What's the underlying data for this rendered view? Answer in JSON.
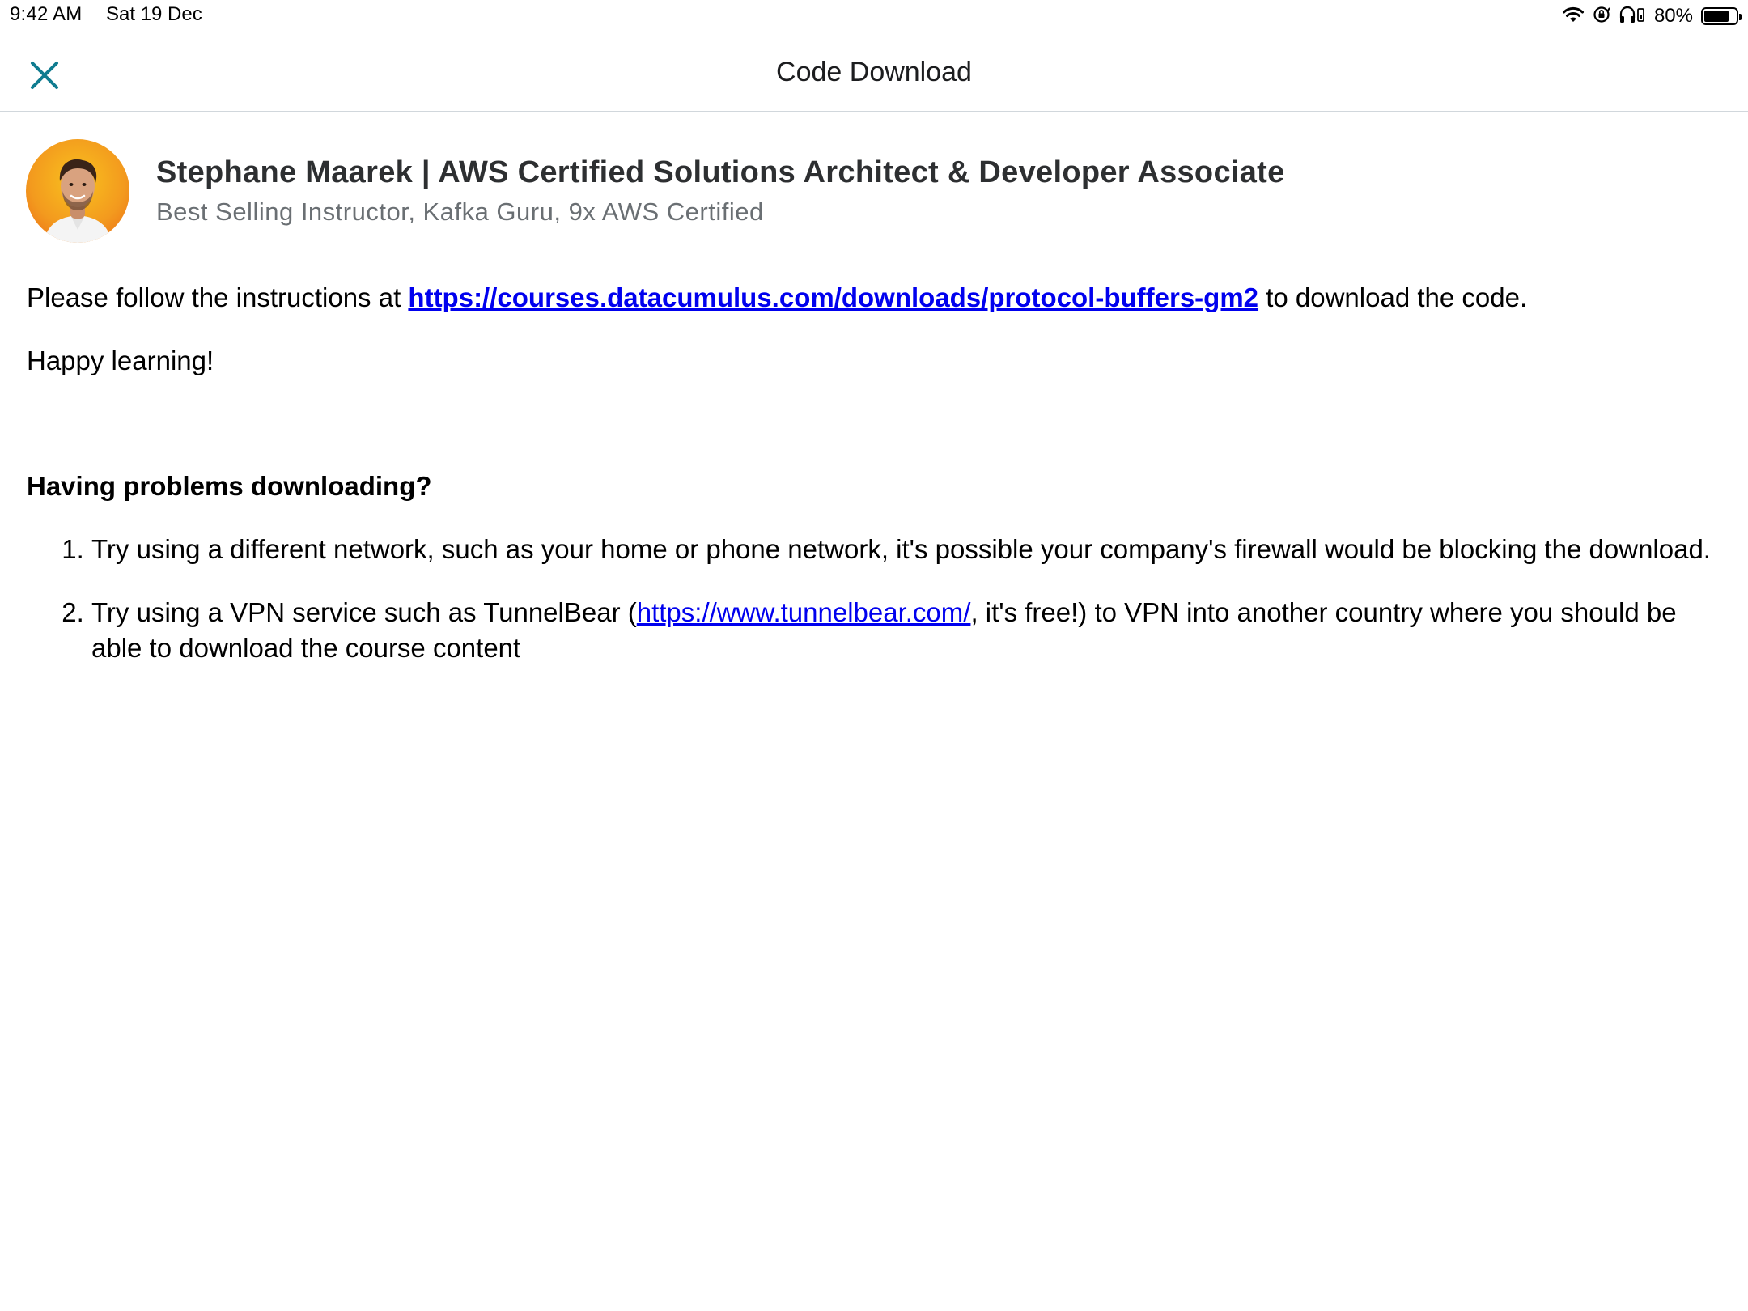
{
  "status_bar": {
    "time": "9:42 AM",
    "date": "Sat 19 Dec",
    "battery_percent_label": "80%",
    "battery_level": 0.8,
    "icons": [
      "wifi-icon",
      "orientation-lock-icon",
      "headphones-icon",
      "battery-icon"
    ]
  },
  "header": {
    "title": "Code Download",
    "close_icon": "close-icon"
  },
  "instructor": {
    "name": "Stephane Maarek | AWS Certified Solutions Architect & Developer Associate",
    "title": "Best Selling Instructor, Kafka Guru, 9x AWS Certified"
  },
  "body": {
    "intro_prefix": "Please follow the instructions at ",
    "intro_link": "https://courses.datacumulus.com/downloads/protocol-buffers-gm2",
    "intro_suffix": " to download the code.",
    "happy": "Happy learning!",
    "problems_heading": "Having problems downloading?",
    "tips": [
      {
        "text": "Try using a different network, such as your home or phone network, it's possible your company's firewall would be blocking the download."
      },
      {
        "prefix": "Try using a VPN service such as TunnelBear (",
        "link": "https://www.tunnelbear.com/",
        "suffix": ", it's free!) to VPN into another country where you should be able to download the course content"
      }
    ]
  },
  "colors": {
    "accent": "#0f7c90",
    "link": "#0000ee",
    "heading": "#1c1d1f",
    "subtitle": "#6a6f73",
    "avatar_bg": "#f39a1e"
  }
}
